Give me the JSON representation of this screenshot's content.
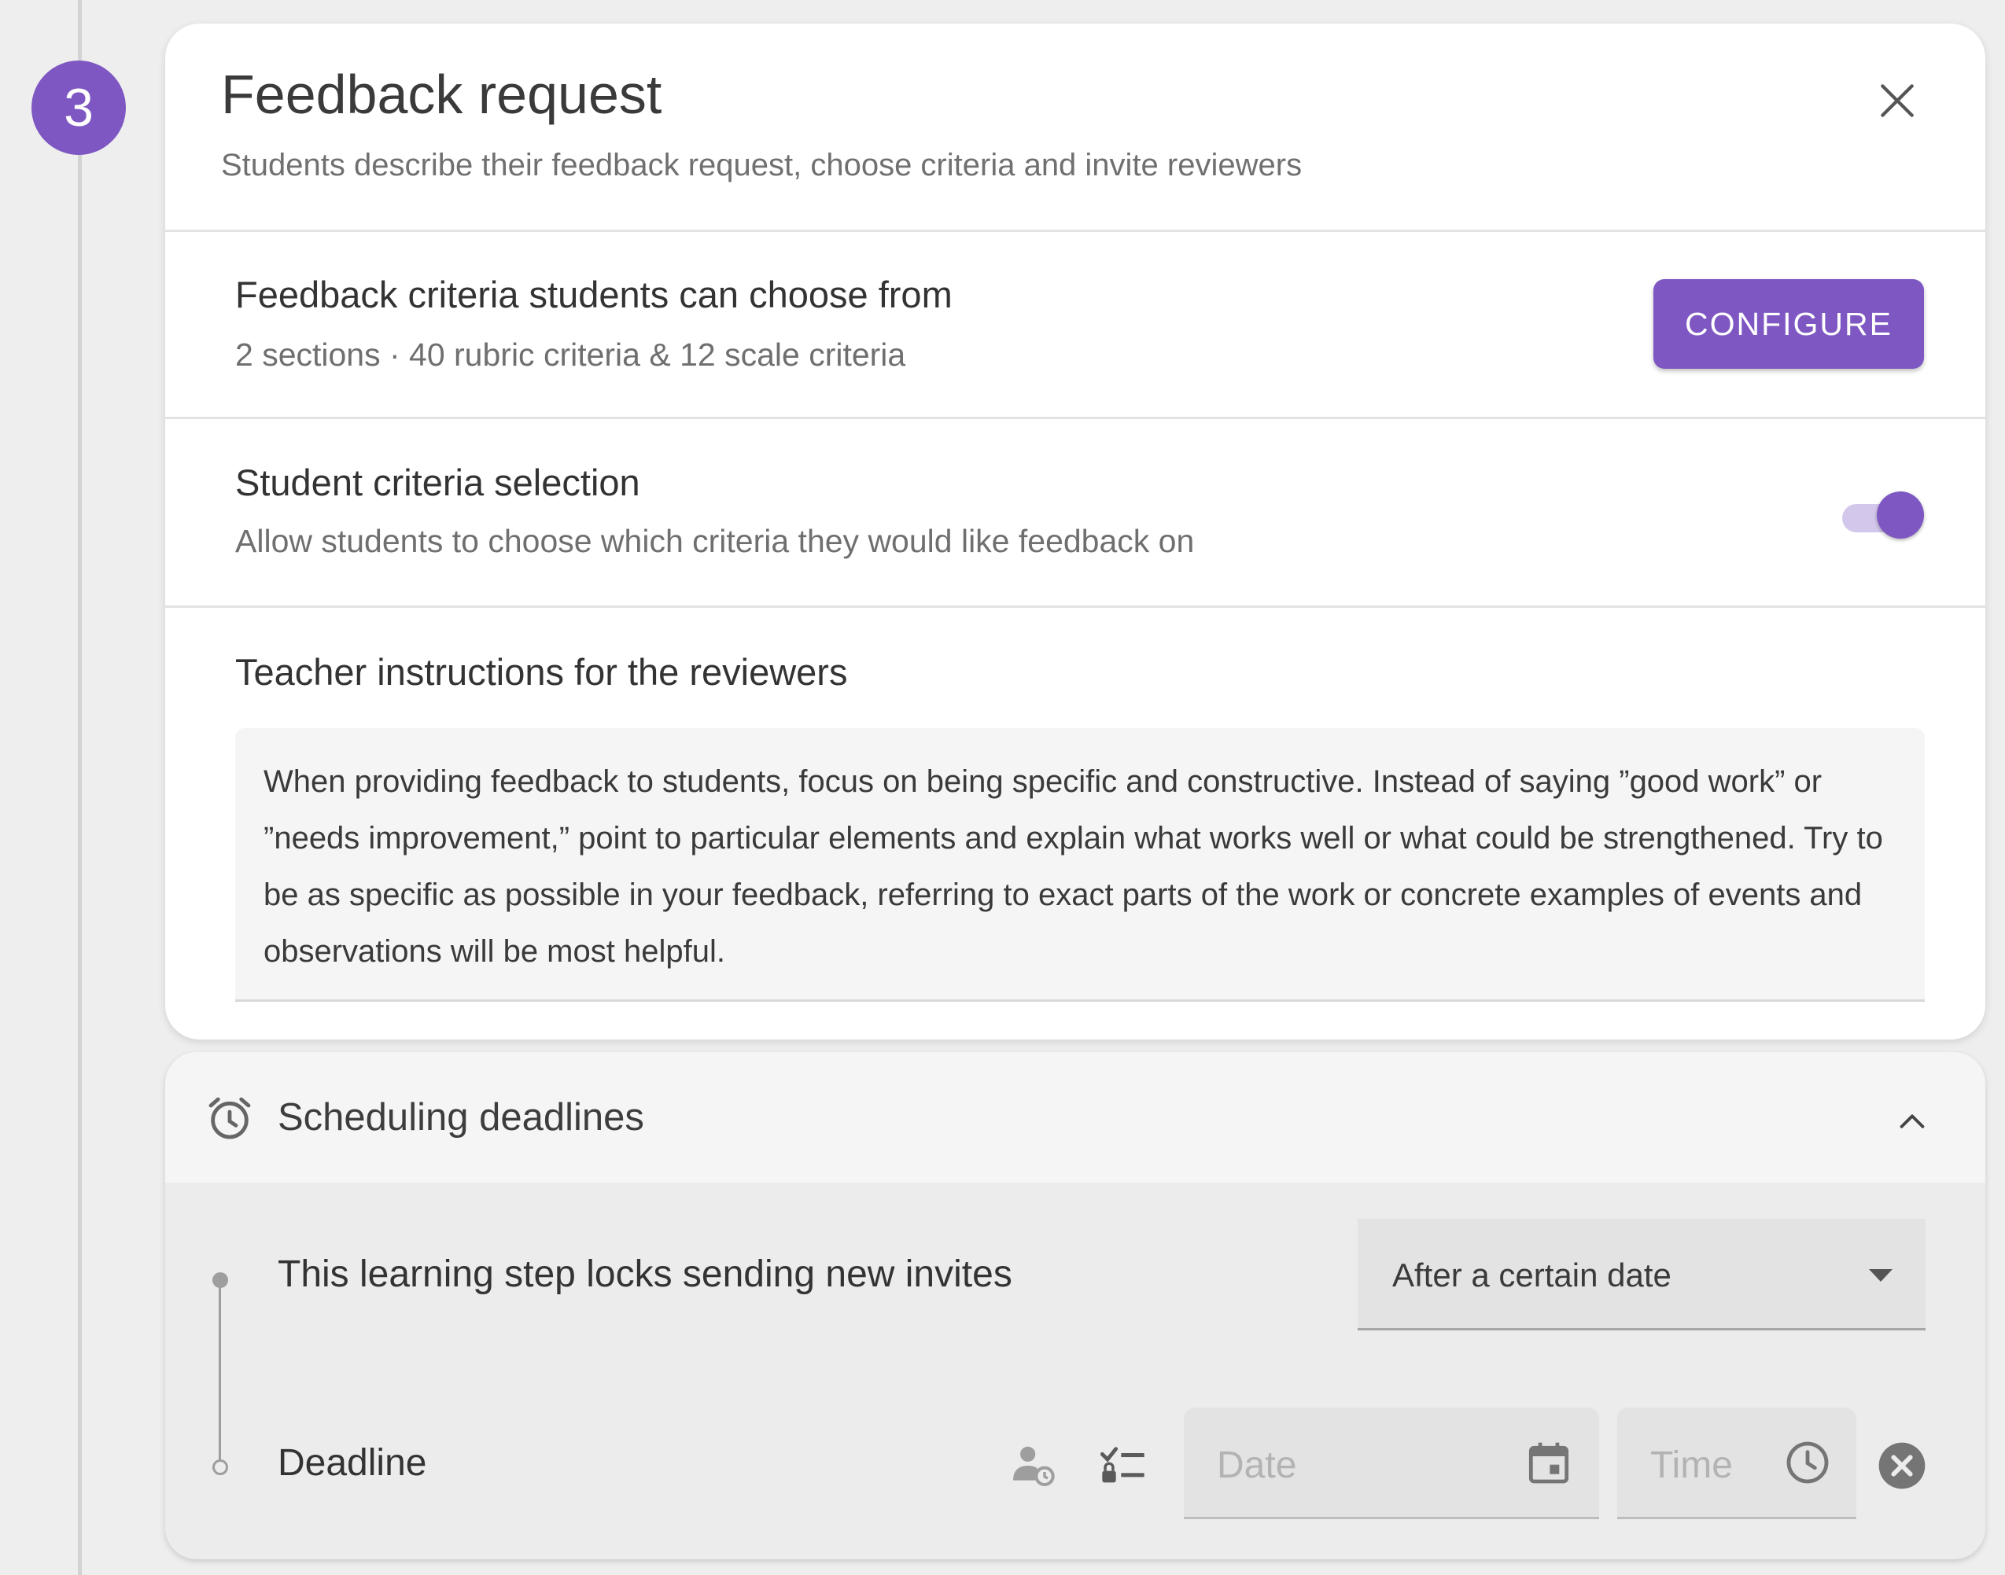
{
  "step": {
    "number": "3"
  },
  "card": {
    "title": "Feedback request",
    "subtitle": "Students describe their feedback request, choose criteria and invite reviewers"
  },
  "criteria": {
    "title": "Feedback criteria students can choose from",
    "summary": "2 sections · 40 rubric criteria & 12 scale criteria",
    "button_label": "CONFIGURE"
  },
  "selection": {
    "title": "Student criteria selection",
    "description": "Allow students to choose which criteria they would like feedback on",
    "enabled": true
  },
  "instructions": {
    "title": "Teacher instructions for the reviewers",
    "text": "When providing feedback to students, focus on being specific and constructive. Instead of saying ”good work” or ”needs improvement,” point to particular elements and explain what works well or what could be strengthened. Try to be as specific as possible in your feedback, referring to exact parts of the work or concrete examples of events and observations will be most helpful."
  },
  "scheduling": {
    "title": "Scheduling deadlines",
    "lock_label": "This learning step locks sending new invites",
    "lock_option": "After a certain date",
    "deadline_label": "Deadline",
    "date_placeholder": "Date",
    "time_placeholder": "Time"
  },
  "colors": {
    "accent": "#7e57c2",
    "accent_light": "#d4c7ec"
  },
  "icons": [
    "close-icon",
    "alarm-icon",
    "chevron-up-icon",
    "dropdown-arrow-icon",
    "person-clock-icon",
    "locked-checklist-icon",
    "calendar-icon",
    "clock-icon",
    "clear-icon"
  ]
}
